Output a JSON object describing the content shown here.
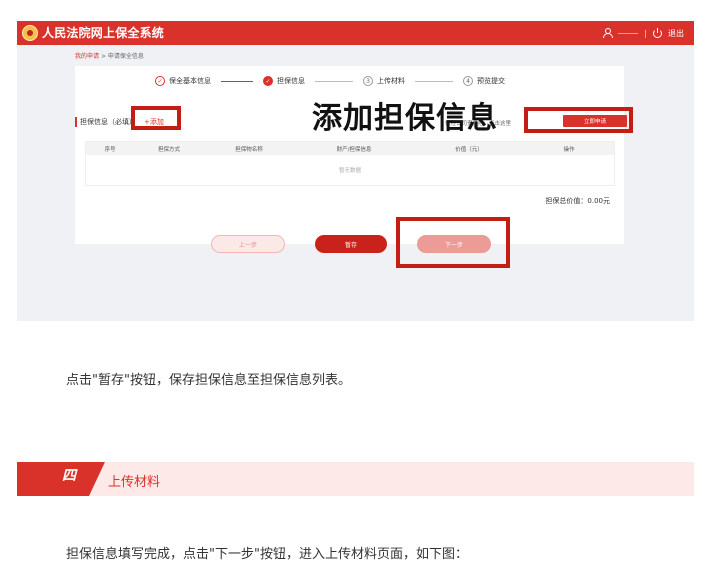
{
  "app": {
    "title": "人民法院网上保全系统",
    "logout": "退出"
  },
  "breadcrumb": {
    "link": "我的申请",
    "sep": ">",
    "current": "申请保全信息"
  },
  "steps": [
    {
      "label": "保全基本信息",
      "num": "✓",
      "state": "done"
    },
    {
      "label": "担保信息",
      "num": "✓",
      "state": "active"
    },
    {
      "label": "上传材料",
      "num": "3",
      "state": "todo"
    },
    {
      "label": "预览提交",
      "num": "4",
      "state": "todo"
    }
  ],
  "guarantee": {
    "title": "担保信息（必填）",
    "add_label": "+添加",
    "overlay_title": "添加担保信息",
    "hint": "保险公司责任险。点击这里",
    "apply_button": "立即申请",
    "columns": [
      "序号",
      "担保方式",
      "担保物名称",
      "财产/担保信息",
      "价值（元）",
      "操作"
    ],
    "empty": "暂无数据",
    "total_label": "担保总价值：0.00元"
  },
  "buttons": {
    "prev": "上一步",
    "save": "暂存",
    "next": "下一步"
  },
  "article": {
    "para1": "点击\"暂存\"按钮，保存担保信息至担保信息列表。",
    "section_num": "四",
    "section_title": "上传材料",
    "para2": "担保信息填写完成，点击\"下一步\"按钮，进入上传材料页面，如下图："
  },
  "colors": {
    "brand_red": "#d9322b",
    "highlight": "#c41e14",
    "banner_bg": "#fde9e7"
  }
}
